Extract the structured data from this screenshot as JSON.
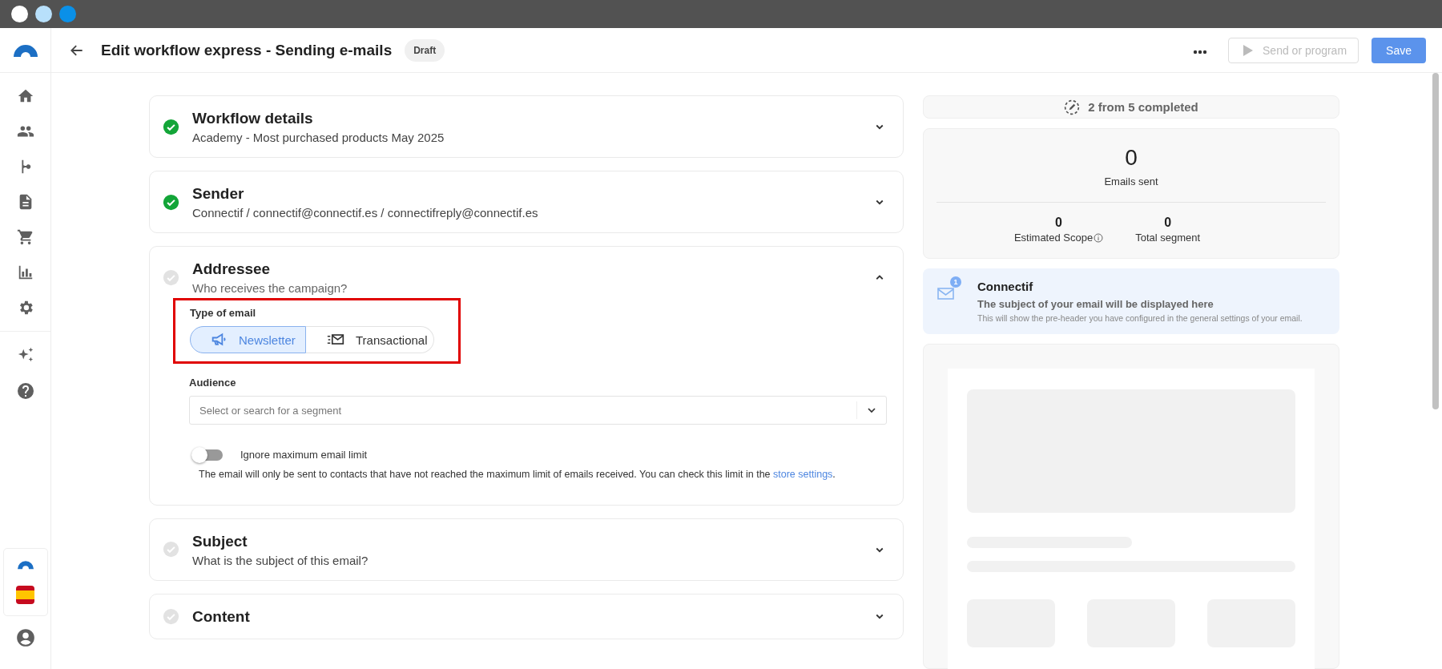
{
  "header": {
    "title": "Edit workflow express - Sending e-mails",
    "status_badge": "Draft",
    "send_button": {
      "label": "Send or program",
      "disabled": true
    },
    "save_button": {
      "label": "Save"
    }
  },
  "sections": [
    {
      "title": "Workflow details",
      "subtitle": "Academy - Most purchased products May 2025",
      "completed": true,
      "expanded": false
    },
    {
      "title": "Sender",
      "subtitle": "Connectif / connectif@connectif.es / connectifreply@connectif.es",
      "completed": true,
      "expanded": false
    },
    {
      "title": "Addressee",
      "subtitle": "Who receives the campaign?",
      "completed": false,
      "expanded": true,
      "type_of_email": {
        "label": "Type of email",
        "options": [
          {
            "kind": "newsletter",
            "label": "Newsletter",
            "selected": true
          },
          {
            "kind": "transactional",
            "label": "Transactional",
            "selected": false
          }
        ]
      },
      "audience": {
        "label": "Audience",
        "placeholder": "Select or search for a segment"
      },
      "limit_toggle": {
        "label": "Ignore maximum email limit",
        "on": false
      },
      "note": {
        "text": "The email will only be sent to contacts that have not reached the maximum limit of emails received. You can check this limit in the ",
        "link": "store settings",
        "end": "."
      }
    },
    {
      "title": "Subject",
      "subtitle": "What is the subject of this email?",
      "completed": false,
      "expanded": false
    },
    {
      "title": "Content",
      "completed": false,
      "expanded": false
    }
  ],
  "progress": {
    "text": "2 from 5 completed"
  },
  "stats": {
    "main": {
      "value": "0",
      "label": "Emails sent"
    },
    "items": [
      {
        "value": "0",
        "label": "Estimated Scope",
        "info": true
      },
      {
        "value": "0",
        "label": "Total segment",
        "info": false
      }
    ]
  },
  "inbox_preview": {
    "badge": "1",
    "sender": "Connectif",
    "subject": "The subject of your email will be displayed here",
    "preheader": "This will show the pre-header you have configured in the general settings of your email."
  }
}
